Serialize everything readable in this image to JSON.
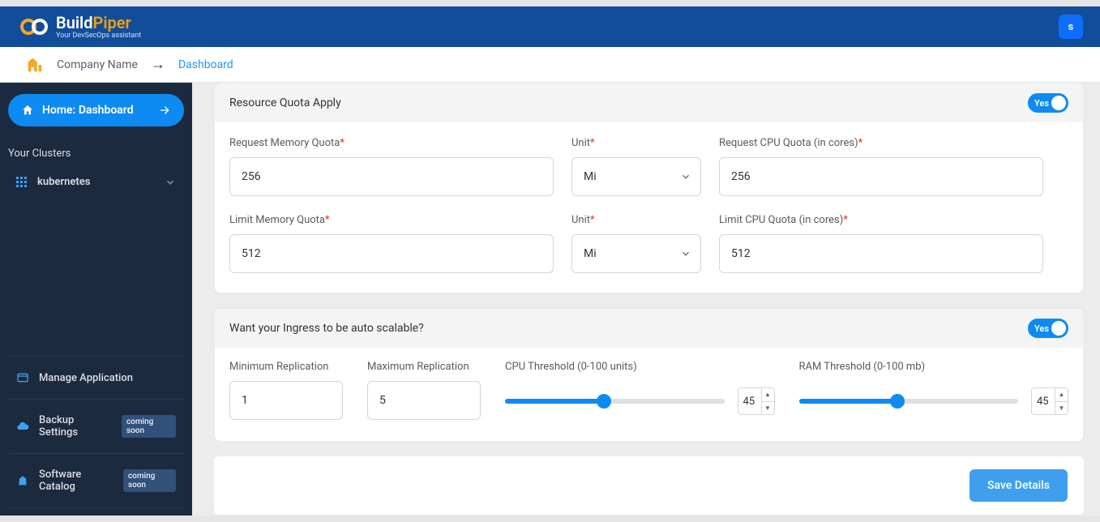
{
  "brand": {
    "part1": "Build",
    "part2": "Piper",
    "tagline": "Your DevSecOps assistant"
  },
  "avatar_letter": "s",
  "breadcrumb": {
    "company": "Company Name",
    "page": "Dashboard"
  },
  "sidebar": {
    "home_label": "Home: Dashboard",
    "section_label": "Your Clusters",
    "cluster_item": "kubernetes",
    "items": [
      {
        "label": "Manage Application",
        "badge": ""
      },
      {
        "label": "Backup Settings",
        "badge": "coming soon"
      },
      {
        "label": "Software Catalog",
        "badge": "coming soon"
      }
    ]
  },
  "quota": {
    "header": "Resource Quota Apply",
    "toggle_label": "Yes",
    "fields": {
      "req_mem_label": "Request Memory Quota",
      "req_mem_value": "256",
      "req_unit_label": "Unit",
      "req_unit_value": "Mi",
      "req_cpu_label": "Request CPU Quota (in cores)",
      "req_cpu_value": "256",
      "lim_mem_label": "Limit Memory Quota",
      "lim_mem_value": "512",
      "lim_unit_label": "Unit",
      "lim_unit_value": "Mi",
      "lim_cpu_label": "Limit CPU Quota (in cores)",
      "lim_cpu_value": "512"
    }
  },
  "scalable": {
    "header": "Want your Ingress to be auto scalable?",
    "toggle_label": "Yes",
    "min_rep_label": "Minimum Replication",
    "min_rep_value": "1",
    "max_rep_label": "Maximum Replication",
    "max_rep_value": "5",
    "cpu_thr_label": "CPU Threshold (0-100 units)",
    "cpu_thr_value": "45",
    "ram_thr_label": "RAM Threshold (0-100 mb)",
    "ram_thr_value": "45"
  },
  "footer": {
    "save_label": "Save Details"
  },
  "unit_options": [
    "Mi"
  ]
}
